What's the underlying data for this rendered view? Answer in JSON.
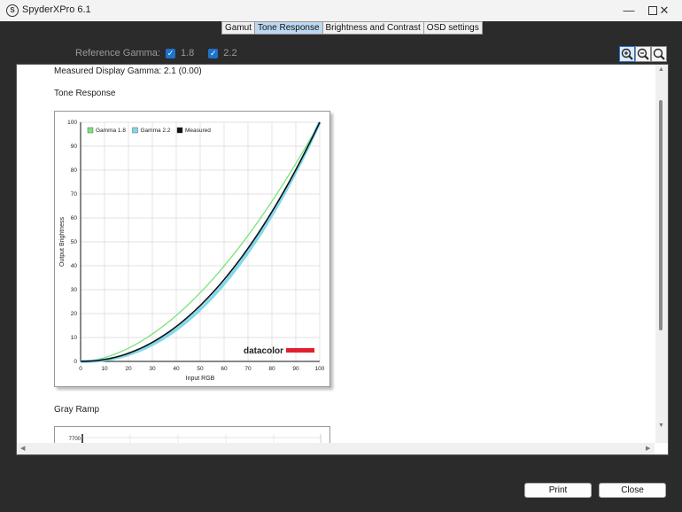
{
  "window": {
    "title": "SpyderXPro 6.1",
    "app_icon_letter": "S"
  },
  "tabs": [
    {
      "label": "Gamut",
      "active": false
    },
    {
      "label": "Tone Response",
      "active": true
    },
    {
      "label": "Brightness and Contrast",
      "active": false
    },
    {
      "label": "OSD settings",
      "active": false
    }
  ],
  "reference": {
    "label": "Reference Gamma:",
    "options": [
      {
        "value": "1.8",
        "checked": true
      },
      {
        "value": "2.2",
        "checked": true
      }
    ]
  },
  "report": {
    "measured_gamma": "Measured Display Gamma: 2.1 (0.00)",
    "tone_title": "Tone Response",
    "gray_title": "Gray Ramp",
    "brand": "datacolor",
    "gray_ramp_top_label": "7700"
  },
  "buttons": {
    "print": "Print",
    "close": "Close"
  },
  "colors": {
    "gamma18": "#7be37b",
    "gamma22": "#7fd9ec",
    "measured": "#111111",
    "brand_red": "#e0202f",
    "accent": "#1e72c9"
  },
  "chart_data": {
    "type": "line",
    "xlabel": "Input RGB",
    "ylabel": "Output Brightness",
    "xlim": [
      0,
      100
    ],
    "ylim": [
      0,
      100
    ],
    "x_ticks": [
      0,
      10,
      20,
      30,
      40,
      50,
      60,
      70,
      80,
      90,
      100
    ],
    "y_ticks": [
      0,
      10,
      20,
      30,
      40,
      50,
      60,
      70,
      80,
      90,
      100
    ],
    "grid": true,
    "legend": "top-left",
    "series": [
      {
        "name": "Gamma 1.8",
        "gamma": 1.8,
        "color": "#7be37b",
        "x": [
          0,
          10,
          20,
          30,
          40,
          50,
          60,
          70,
          80,
          90,
          100
        ],
        "values": [
          0,
          1.6,
          5.5,
          11.5,
          19.2,
          28.7,
          39.9,
          52.6,
          66.9,
          82.7,
          100
        ]
      },
      {
        "name": "Gamma 2.2",
        "gamma": 2.2,
        "color": "#7fd9ec",
        "x": [
          0,
          10,
          20,
          30,
          40,
          50,
          60,
          70,
          80,
          90,
          100
        ],
        "values": [
          0,
          0.6,
          2.9,
          7.1,
          13.3,
          21.8,
          32.5,
          45.6,
          61.2,
          79.3,
          100
        ]
      },
      {
        "name": "Measured",
        "gamma": 2.1,
        "color": "#111111",
        "x": [
          0,
          10,
          20,
          30,
          40,
          50,
          60,
          70,
          80,
          90,
          100
        ],
        "values": [
          0,
          0.8,
          3.4,
          8.0,
          14.6,
          23.3,
          34.2,
          47.3,
          62.6,
          80.1,
          100
        ]
      }
    ]
  }
}
